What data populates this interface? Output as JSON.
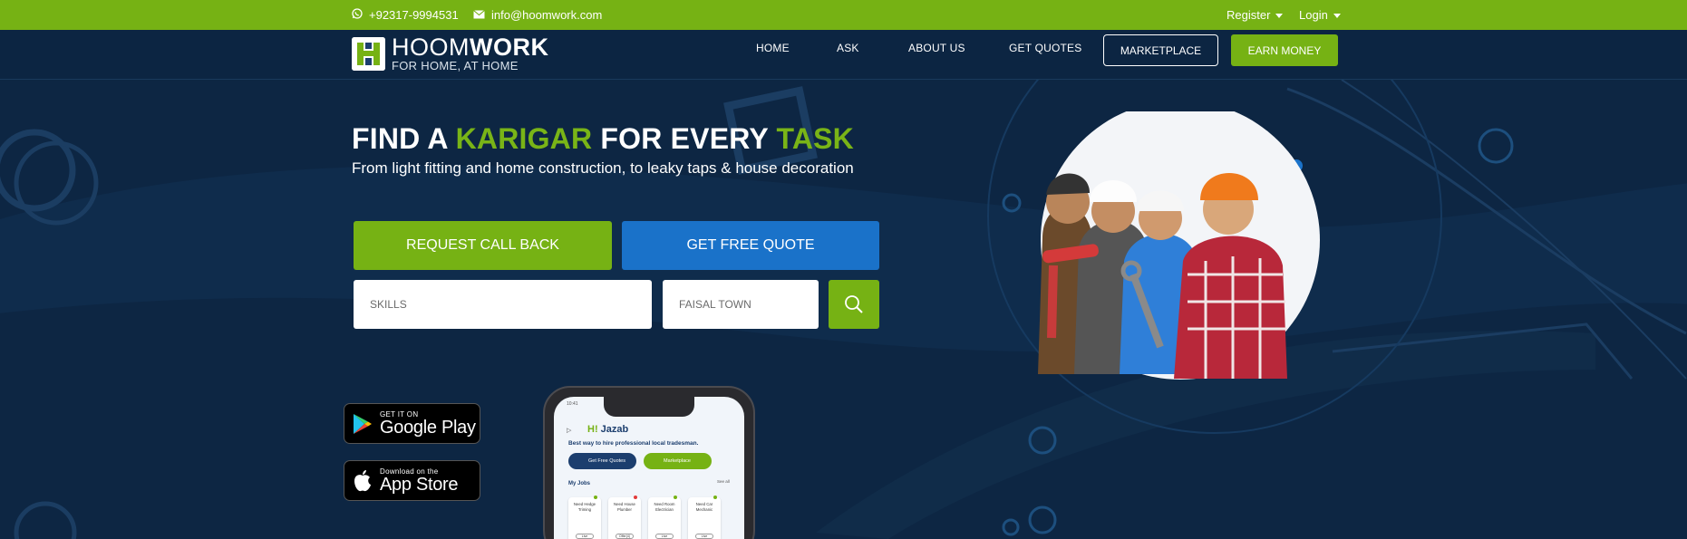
{
  "topbar": {
    "phone": "+92317-9994531",
    "email": "info@hoomwork.com",
    "register": "Register",
    "login": "Login"
  },
  "brand": {
    "name_light": "HOOM",
    "name_bold": "WORK",
    "tagline": "FOR HOME, AT HOME"
  },
  "nav": {
    "items": [
      "HOME",
      "ASK",
      "ABOUT US",
      "GET QUOTES"
    ],
    "marketplace": "MARKETPLACE",
    "earn": "EARN MONEY"
  },
  "hero": {
    "title_1": "FIND A ",
    "title_2": "KARIGAR",
    "title_3": " FOR EVERY ",
    "title_4": "TASK",
    "subtitle": "From light fitting and home construction, to leaky taps & house decoration",
    "callback_label": "REQUEST CALL BACK",
    "quote_label": "GET FREE QUOTE",
    "skills_placeholder": "SKILLS",
    "location_value": "FAISAL TOWN"
  },
  "stores": {
    "google_small": "GET IT ON",
    "google_big": "Google Play",
    "apple_small": "Download on the",
    "apple_big": "App Store"
  },
  "phone_screen": {
    "time": "10:41",
    "greeting_hi": "H!",
    "greeting_name": " Jazab",
    "tagline": "Best way to hire professional local tradesman.",
    "btn_quotes": "Get Free Quotes",
    "btn_market": "Marketplace",
    "jobs_title": "My Jobs",
    "see_all": "See all",
    "cards": [
      {
        "l1": "Need Hedge",
        "l2": "Triming",
        "btn": "Live",
        "dot": "#76b214"
      },
      {
        "l1": "Need House",
        "l2": "Plumber",
        "btn": "Offer(4)",
        "dot": "#e23b3b"
      },
      {
        "l1": "Need Room",
        "l2": "Electrician",
        "btn": "Live",
        "dot": "#76b214"
      },
      {
        "l1": "Need Car",
        "l2": "Mechanic",
        "btn": "Live",
        "dot": "#76b214"
      }
    ]
  },
  "colors": {
    "green": "#76b214",
    "blue": "#1a72c9",
    "navy": "#0d2643"
  }
}
